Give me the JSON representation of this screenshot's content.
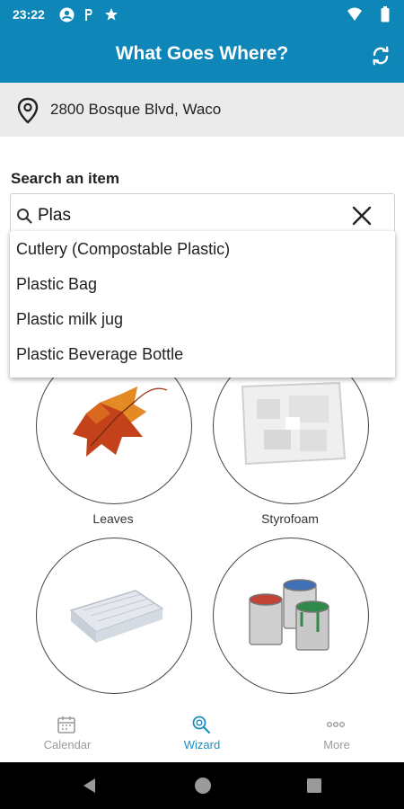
{
  "status_bar": {
    "time": "23:22",
    "icons": [
      "account-circle-icon",
      "parking-icon",
      "star-icon",
      "wifi-icon",
      "battery-icon"
    ]
  },
  "app_bar": {
    "title": "What Goes Where?",
    "refresh_icon": "refresh-icon",
    "color": "#0f86b8"
  },
  "location": {
    "icon": "location-pin-icon",
    "address": "2800 Bosque Blvd, Waco"
  },
  "search": {
    "label": "Search an item",
    "value": "Plas",
    "clear_icon": "close-icon"
  },
  "suggestions": [
    "Cutlery (Compostable Plastic)",
    "Plastic Bag",
    "Plastic milk jug",
    "Plastic Beverage Bottle"
  ],
  "grid_items": [
    {
      "label": "Leaves",
      "icon": "leaf-image"
    },
    {
      "label": "Styrofoam",
      "icon": "styrofoam-image"
    },
    {
      "label": "",
      "icon": "mattress-image"
    },
    {
      "label": "",
      "icon": "paint-cans-image"
    }
  ],
  "bottom_nav": [
    {
      "label": "Calendar",
      "icon": "calendar-icon",
      "active": false
    },
    {
      "label": "Wizard",
      "icon": "wizard-search-icon",
      "active": true
    },
    {
      "label": "More",
      "icon": "more-dots-icon",
      "active": false
    }
  ],
  "colors": {
    "accent": "#0f86b8",
    "nav_active": "#1a8fc2",
    "nav_inactive": "#9a9a9a"
  }
}
